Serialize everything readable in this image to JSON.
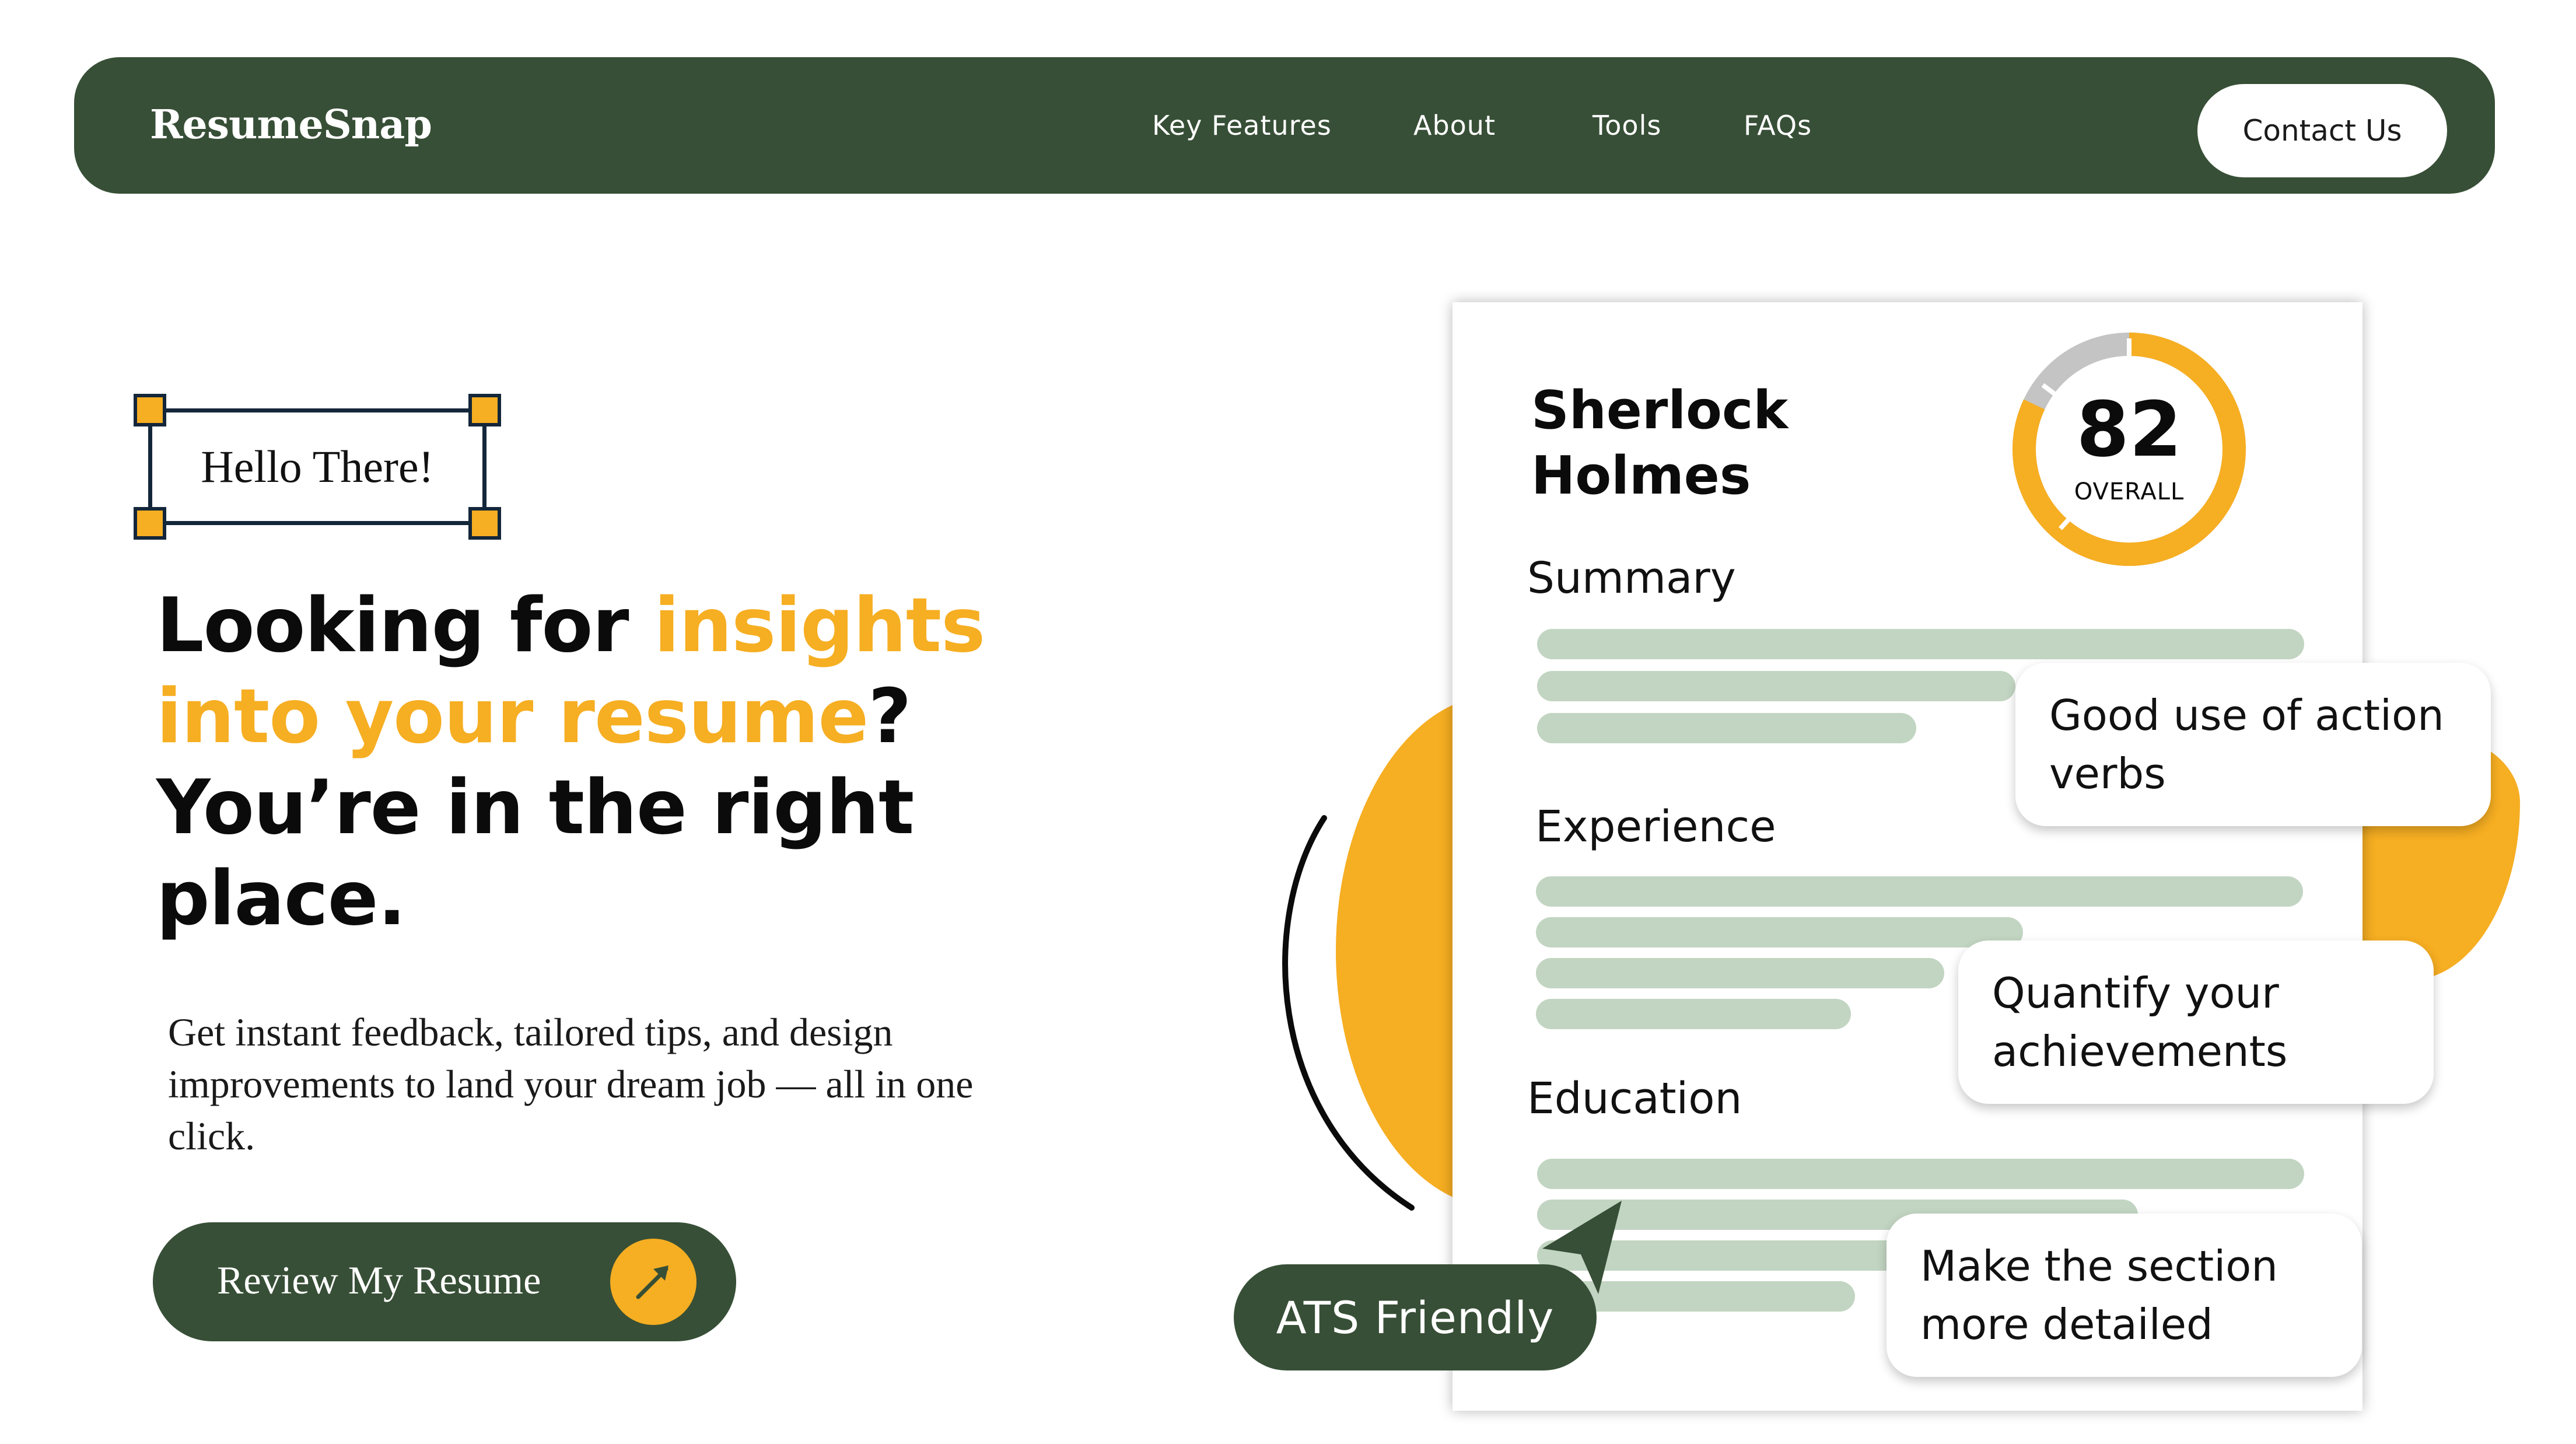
{
  "nav": {
    "logo": "ResumeSnap",
    "links": [
      "Key Features",
      "About",
      "Tools",
      "FAQs"
    ],
    "contact_label": "Contact Us"
  },
  "hero": {
    "tag": "Hello There!",
    "headline_1": "Looking for ",
    "headline_highlight": "insights into your resume",
    "headline_2": "? You’re in the right place.",
    "subtext": "Get instant feedback, tailored tips, and design improvements to land your dream job — all in one click.",
    "cta_label": "Review My Resume",
    "cta_icon": "arrow-up-right-icon"
  },
  "resume": {
    "name": "Sherlock Holmes",
    "score": "82",
    "score_label": "OVERALL",
    "score_fraction": 0.82,
    "sections": [
      "Summary",
      "Experience",
      "Education"
    ]
  },
  "feedback": [
    "Good use of action verbs",
    "Quantify your achievements",
    "Make the section more detailed"
  ],
  "badge": "ATS Friendly",
  "colors": {
    "primary": "#374f36",
    "accent": "#f6ae22",
    "line": "#c2d5c2",
    "gauge_track": "#c4c4c4"
  }
}
